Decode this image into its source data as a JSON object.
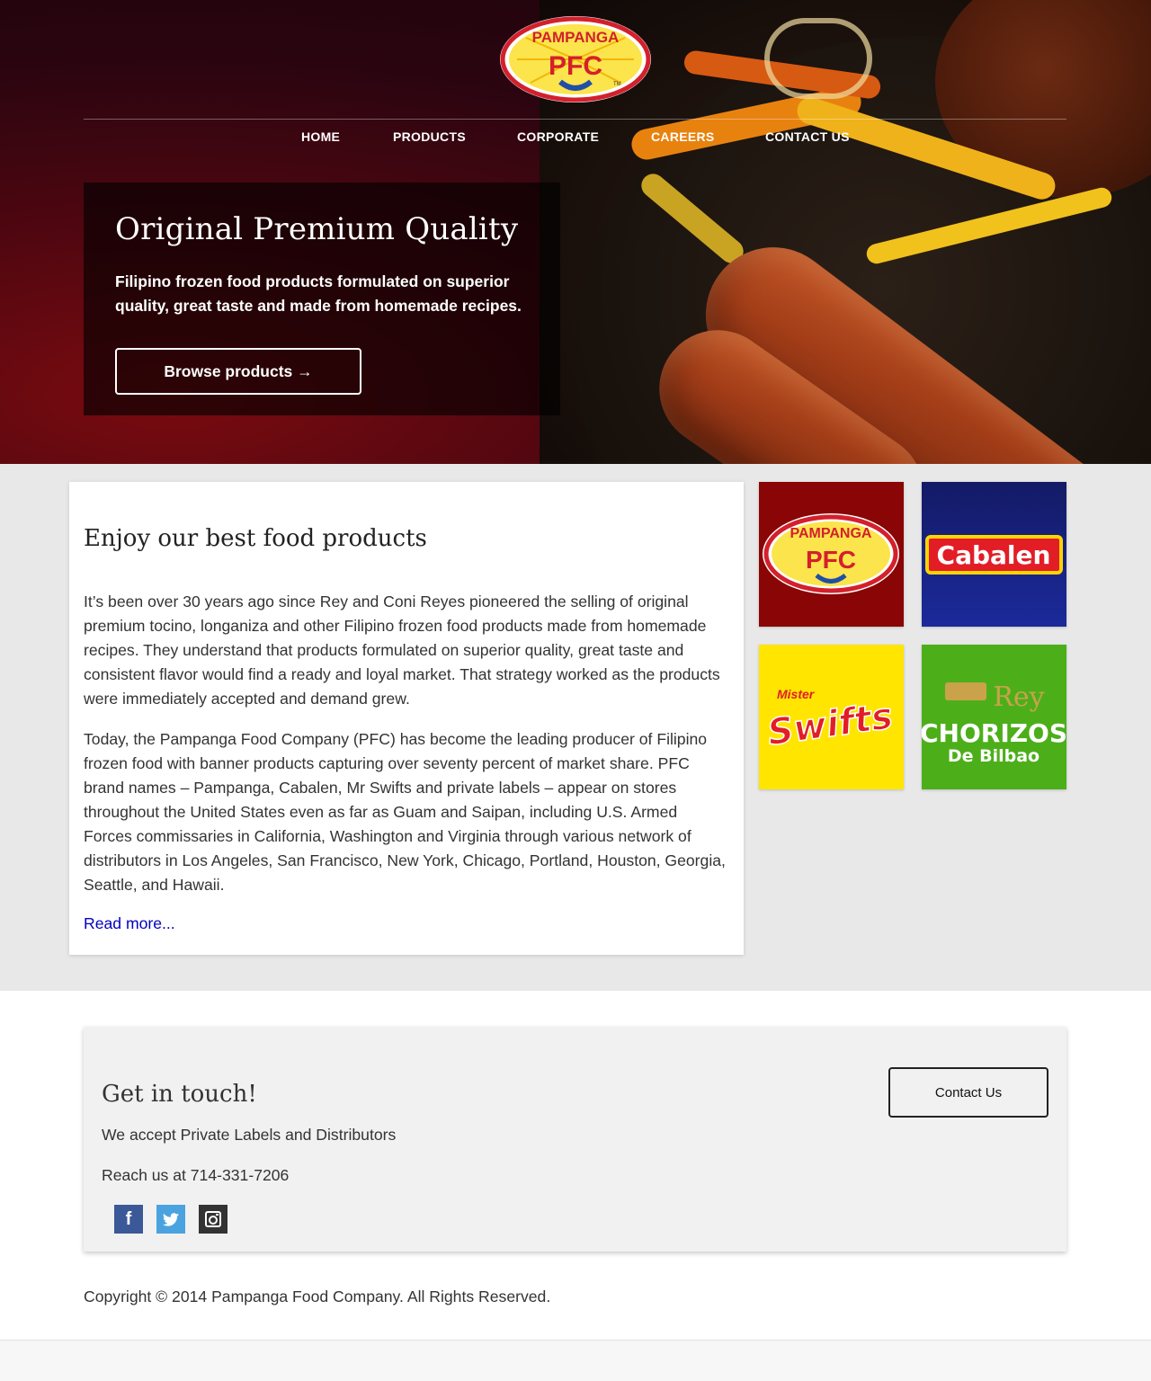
{
  "logo": {
    "brand_text": "PAMPANGA",
    "monogram": "PFC",
    "tm": "TM"
  },
  "nav": {
    "items": [
      {
        "label": "HOME"
      },
      {
        "label": "PRODUCTS"
      },
      {
        "label": "CORPORATE"
      },
      {
        "label": "CAREERS"
      },
      {
        "label": "CONTACT US"
      }
    ]
  },
  "hero": {
    "title": "Original Premium Quality",
    "subtitle": "Filipino frozen food products formulated on superior quality, great taste and made from homemade recipes.",
    "button_label": "Browse products →"
  },
  "about": {
    "heading": "Enjoy our best food products",
    "paragraph1": "It’s been over 30 years ago since Rey and Coni Reyes pioneered the selling of original premium tocino, longaniza and other Filipino frozen food products made from homemade recipes. They understand that products formulated on superior quality, great taste and consistent flavor would find a ready and loyal market. That strategy worked as the products were immediately accepted and demand grew.",
    "paragraph2": "Today, the Pampanga Food Company (PFC) has become the leading producer of Filipino frozen food with banner products capturing over seventy percent of market share. PFC brand names – Pampanga, Cabalen, Mr Swifts and private labels – appear on stores throughout the United States even as far as Guam and Saipan, including U.S. Armed Forces commissaries in California, Washington and Virginia through various network of distributors in Los Angeles, San Francisco, New York, Chicago, Portland, Houston, Georgia, Seattle, and Hawaii.",
    "read_more": "Read more..."
  },
  "brands": [
    {
      "name": "PAMPANGA",
      "monogram": "PFC",
      "bg": "#8a0a0a"
    },
    {
      "name": "Cabalen",
      "bg": "#1a237e"
    },
    {
      "name": "Swifts",
      "prefix": "Mister",
      "bg": "#ffe500"
    },
    {
      "name": "Rey",
      "line2": "CHORIZOS",
      "line3": "De Bilbao",
      "bg": "#4caf1a"
    }
  ],
  "contact": {
    "heading": "Get in touch!",
    "line1": "We accept Private Labels and Distributors",
    "line2": "Reach us at 714-331-7206",
    "button_label": "Contact Us",
    "social": [
      {
        "icon": "facebook-icon",
        "glyph": "f",
        "color": "#3b5998"
      },
      {
        "icon": "twitter-icon",
        "glyph": "t",
        "color": "#4aa3df"
      },
      {
        "icon": "instagram-icon",
        "glyph": "◙",
        "color": "#333333"
      }
    ]
  },
  "footer": {
    "copyright": "Copyright © 2014 Pampanga Food Company. All Rights Reserved."
  }
}
